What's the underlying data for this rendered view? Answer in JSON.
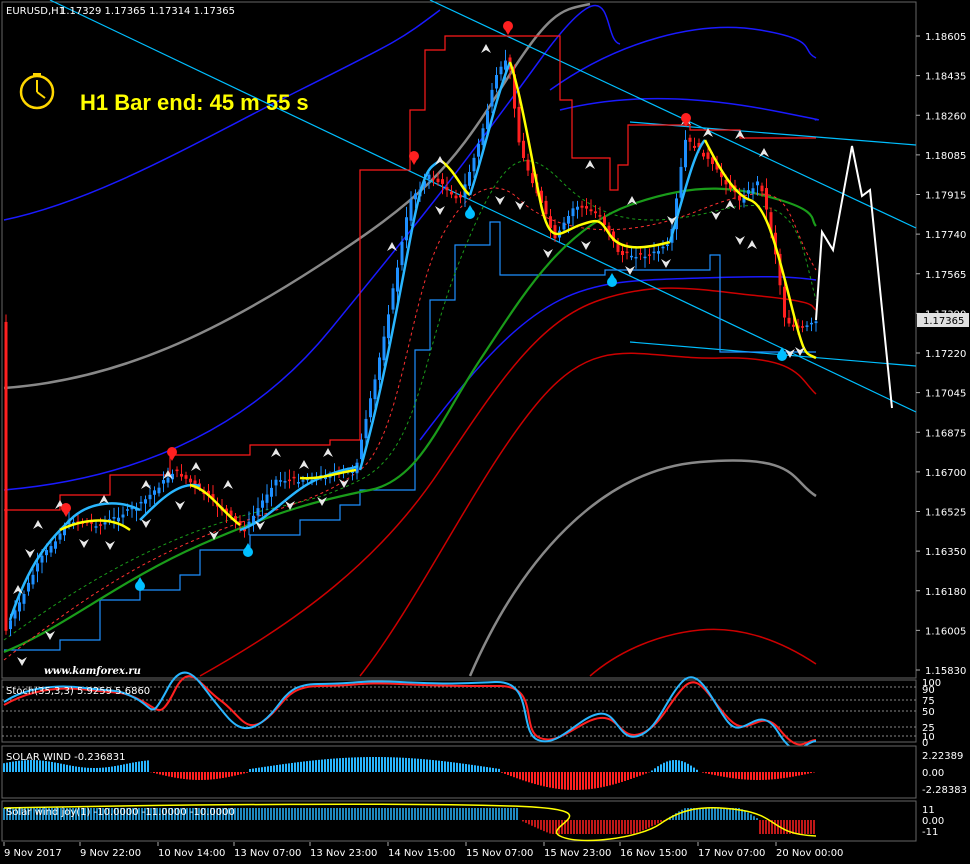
{
  "header": {
    "symbol": "EURUSD,H1",
    "ohlc": "1.17329 1.17365 1.17314 1.17365"
  },
  "timer": {
    "label": "H1 Bar end: 45 m 55 s"
  },
  "watermark": "www.kamforex.ru",
  "price_axis": {
    "ticks": [
      "1.18605",
      "1.18435",
      "1.18260",
      "1.18085",
      "1.17915",
      "1.17740",
      "1.17565",
      "1.17390",
      "1.17220",
      "1.17045",
      "1.16875",
      "1.16700",
      "1.16525",
      "1.16350",
      "1.16180",
      "1.16005",
      "1.15830"
    ],
    "current": "1.17365"
  },
  "time_axis": {
    "ticks": [
      "9 Nov 2017",
      "9 Nov 22:00",
      "10 Nov 14:00",
      "13 Nov 07:00",
      "13 Nov 23:00",
      "14 Nov 15:00",
      "15 Nov 07:00",
      "15 Nov 23:00",
      "16 Nov 15:00",
      "17 Nov 07:00",
      "20 Nov 00:00"
    ]
  },
  "subwindows": {
    "stoch": {
      "label": "Stoch(35,3,3) 5.9259 5.6860",
      "levels": [
        "100",
        "90",
        "75",
        "50",
        "25",
        "10",
        "0"
      ]
    },
    "solar": {
      "label": "SOLAR WIND -0.236831",
      "levels": [
        "2.22389",
        "0.00",
        "-2.28383"
      ]
    },
    "solar_joy": {
      "label": "Solar wind joy(1) -10.0000 -11.0000 -10.0000",
      "levels": [
        "11",
        "0.00",
        "-11"
      ]
    }
  },
  "colors": {
    "bull": "#1e90ff",
    "bear": "#ff2020",
    "channel": "#00bfff",
    "timer": "#ffff00",
    "arrow_up": "#00bfff",
    "arrow_down": "#ff2020"
  },
  "icons": {
    "timer": "clock-icon",
    "arrow_up": "arrow-up-icon",
    "arrow_down": "arrow-down-icon"
  }
}
